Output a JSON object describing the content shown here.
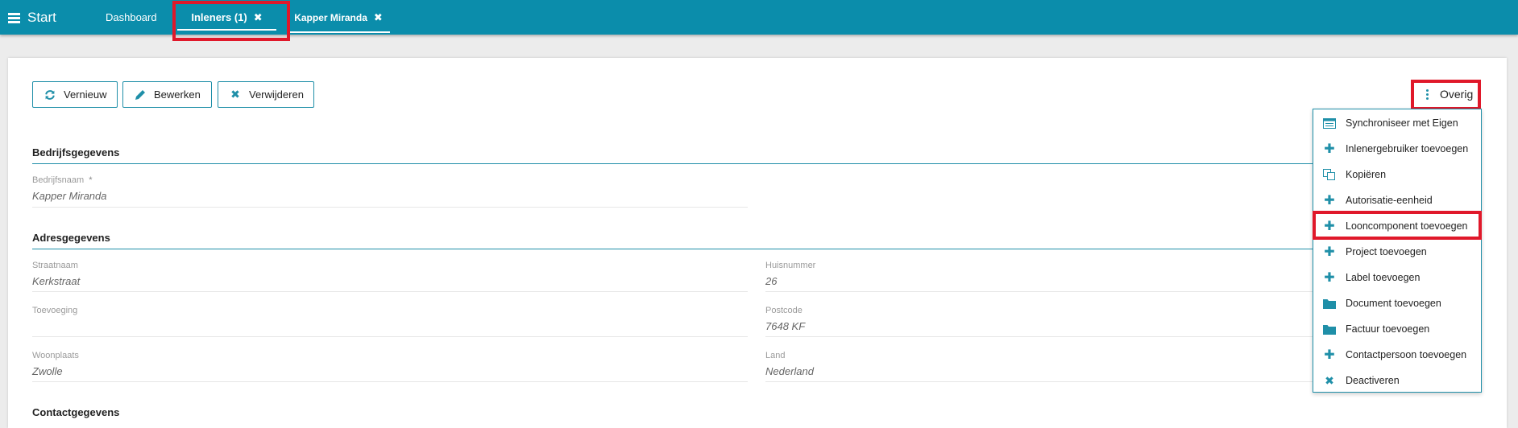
{
  "topbar": {
    "start_label": "Start",
    "tabs": [
      {
        "label": "Dashboard"
      },
      {
        "label": "Inleners (1)",
        "close": "✖"
      },
      {
        "label": "Kapper Miranda",
        "close": "✖"
      }
    ]
  },
  "toolbar": {
    "refresh_label": "Vernieuw",
    "edit_label": "Bewerken",
    "delete_label": "Verwijderen",
    "more_label": "Overig"
  },
  "sections": {
    "bedrijf": {
      "title": "Bedrijfsgegevens",
      "bedrijfsnaam_label": "Bedrijfsnaam",
      "required_mark": "*",
      "bedrijfsnaam_value": "Kapper Miranda"
    },
    "adres": {
      "title": "Adresgegevens",
      "straatnaam_label": "Straatnaam",
      "straatnaam_value": "Kerkstraat",
      "huisnummer_label": "Huisnummer",
      "huisnummer_value": "26",
      "toevoeging_label": "Toevoeging",
      "toevoeging_value": "",
      "postcode_label": "Postcode",
      "postcode_value": "7648 KF",
      "woonplaats_label": "Woonplaats",
      "woonplaats_value": "Zwolle",
      "land_label": "Land",
      "land_value": "Nederland"
    },
    "contact": {
      "title": "Contactgegevens"
    }
  },
  "menu": {
    "items": [
      {
        "label": "Synchroniseer met Eigen",
        "icon": "sync-list-icon"
      },
      {
        "label": "Inlenergebruiker toevoegen",
        "icon": "plus-icon"
      },
      {
        "label": "Kopiëren",
        "icon": "copy-icon"
      },
      {
        "label": "Autorisatie-eenheid",
        "icon": "plus-icon"
      },
      {
        "label": "Looncomponent toevoegen",
        "icon": "plus-icon"
      },
      {
        "label": "Project toevoegen",
        "icon": "plus-icon"
      },
      {
        "label": "Label toevoegen",
        "icon": "plus-icon"
      },
      {
        "label": "Document toevoegen",
        "icon": "folder-icon"
      },
      {
        "label": "Factuur toevoegen",
        "icon": "folder-icon"
      },
      {
        "label": "Contactpersoon toevoegen",
        "icon": "plus-icon"
      },
      {
        "label": "Deactiveren",
        "icon": "close-icon"
      }
    ]
  },
  "colors": {
    "topbar": "#0b8dab",
    "accent": "#1f8fa8",
    "highlight": "#e0182a"
  }
}
